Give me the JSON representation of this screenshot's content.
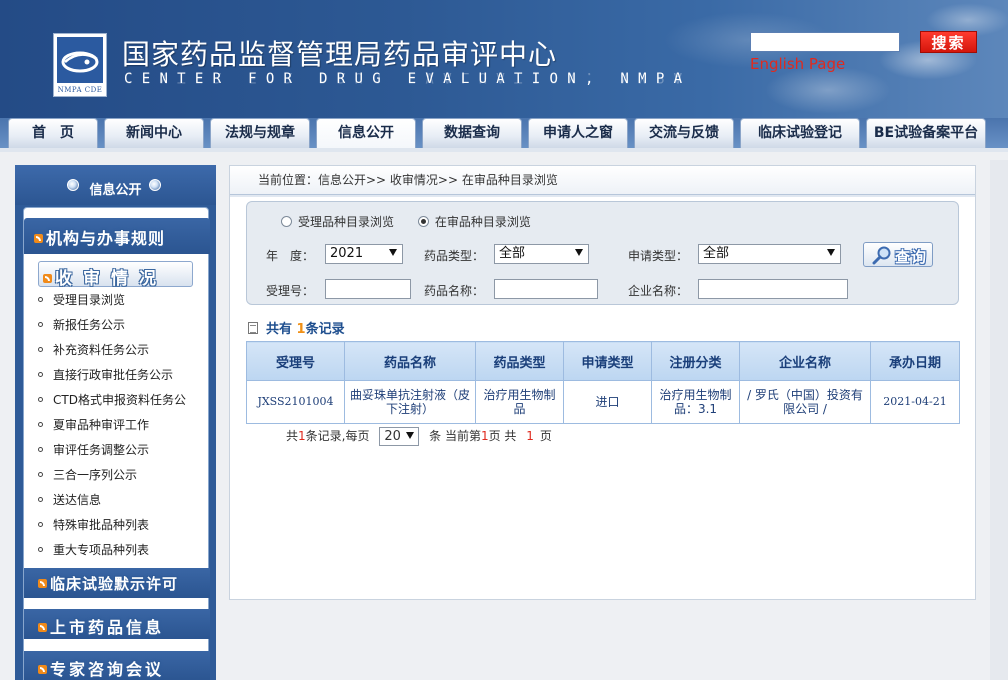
{
  "header": {
    "title": "国家药品监督管理局药品审评中心",
    "subtitle": "CENTER FOR DRUG EVALUATION, NMPA",
    "logo_text": "NMPA CDE",
    "search_placeholder": "",
    "search_button": "搜索",
    "english_link": "English Page"
  },
  "nav": {
    "tabs": [
      {
        "label": "首　页"
      },
      {
        "label": "新闻中心"
      },
      {
        "label": "法规与规章"
      },
      {
        "label": "信息公开"
      },
      {
        "label": "数据查询"
      },
      {
        "label": "申请人之窗"
      },
      {
        "label": "交流与反馈"
      },
      {
        "label": "临床试验登记"
      },
      {
        "label": "BE试验备案平台"
      }
    ],
    "active": "信息公开"
  },
  "sidebar": {
    "title": "信息公开",
    "section_rules": "机构与办事规则",
    "section_active": "收审情况",
    "items": [
      "受理目录浏览",
      "新报任务公示",
      "补充资料任务公示",
      "直接行政审批任务公示",
      "CTD格式申报资料任务公",
      "夏审品种审评工作",
      "审评任务调整公示",
      "三合一序列公示",
      "送达信息",
      "特殊审批品种列表",
      "重大专项品种列表"
    ],
    "section_clinical": "临床试验默示许可",
    "section_market": "上市药品信息",
    "section_expert": "专家咨询会议"
  },
  "main": {
    "breadcrumb": "当前位置：信息公开>> 收审情况>> 在审品种目录浏览",
    "filters": {
      "radio_option_1": "受理品种目录浏览",
      "radio_option_2": "在审品种目录浏览",
      "year_label": "年　度：",
      "year_value": "2021",
      "drug_type_label": "药品类型：",
      "drug_type_value": "全部",
      "apply_type_label": "申请类型：",
      "apply_type_value": "全部",
      "accept_no_label": "受理号：",
      "drug_name_label": "药品名称：",
      "company_label": "企业名称：",
      "query_button": "查询"
    },
    "records": {
      "prefix": "共有",
      "count": "1",
      "suffix": "条记录"
    },
    "table": {
      "headers": [
        "受理号",
        "药品名称",
        "药品类型",
        "申请类型",
        "注册分类",
        "企业名称",
        "承办日期"
      ],
      "rows": [
        [
          "JXSS2101004",
          "曲妥珠单抗注射液（皮下注射）",
          "治疗用生物制品",
          "进口",
          "治疗用生物制品：3.1",
          "/ 罗氏（中国）投资有限公司 /",
          "2021-04-21"
        ]
      ]
    },
    "pager": {
      "total_prefix": "共",
      "total_count": "1",
      "total_mid": "条记录,每页",
      "page_size": "20",
      "current_prefix": "条 当前第",
      "current_page": "1",
      "current_mid": "页 共",
      "total_pages": "1",
      "total_suffix": "页"
    }
  }
}
